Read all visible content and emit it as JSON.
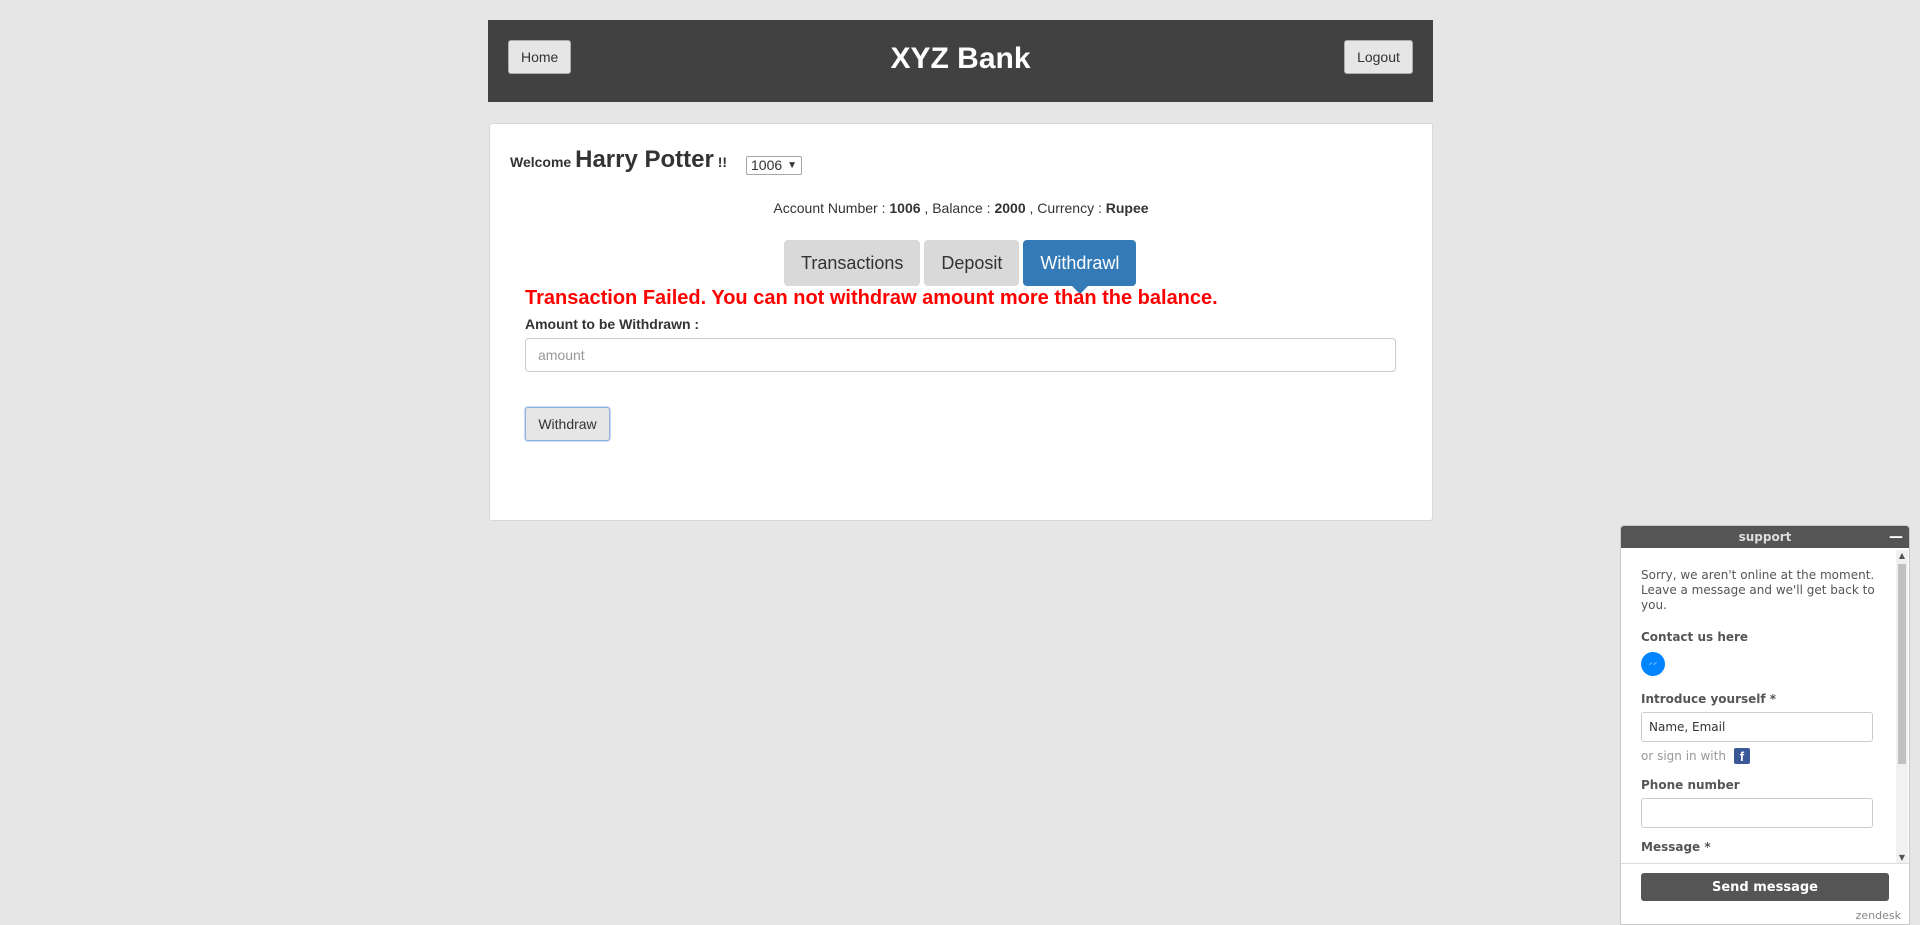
{
  "header": {
    "title": "XYZ Bank",
    "home_label": "Home",
    "logout_label": "Logout"
  },
  "welcome": {
    "prefix": "Welcome",
    "name": "Harry Potter",
    "suffix": "!!",
    "selected_account": "1006"
  },
  "account_info": {
    "account_label": "Account Number :",
    "account_number": "1006",
    "balance_label": ", Balance :",
    "balance": "2000",
    "currency_label": ", Currency :",
    "currency": "Rupee"
  },
  "tabs": [
    {
      "label": "Transactions",
      "active": false
    },
    {
      "label": "Deposit",
      "active": false
    },
    {
      "label": "Withdrawl",
      "active": true
    }
  ],
  "form": {
    "error_message": "Transaction Failed. You can not withdraw amount more than the balance.",
    "amount_label": "Amount to be Withdrawn :",
    "amount_placeholder": "amount",
    "amount_value": "",
    "submit_label": "Withdraw"
  },
  "support": {
    "title": "support",
    "minimize_icon": "minimize-icon",
    "offline_message": "Sorry, we aren't online at the moment. Leave a message and we'll get back to you.",
    "contact_label": "Contact us here",
    "introduce_label": "Introduce yourself *",
    "introduce_placeholder": "Name, Email",
    "signin_text": "or sign in with",
    "phone_label": "Phone number",
    "message_label": "Message *",
    "send_label": "Send message",
    "brand": "zendesk"
  },
  "colors": {
    "header_bg": "#414141",
    "active_tab": "#337ab7",
    "error": "#ff0000",
    "messenger": "#0084ff",
    "facebook": "#3b5998"
  }
}
